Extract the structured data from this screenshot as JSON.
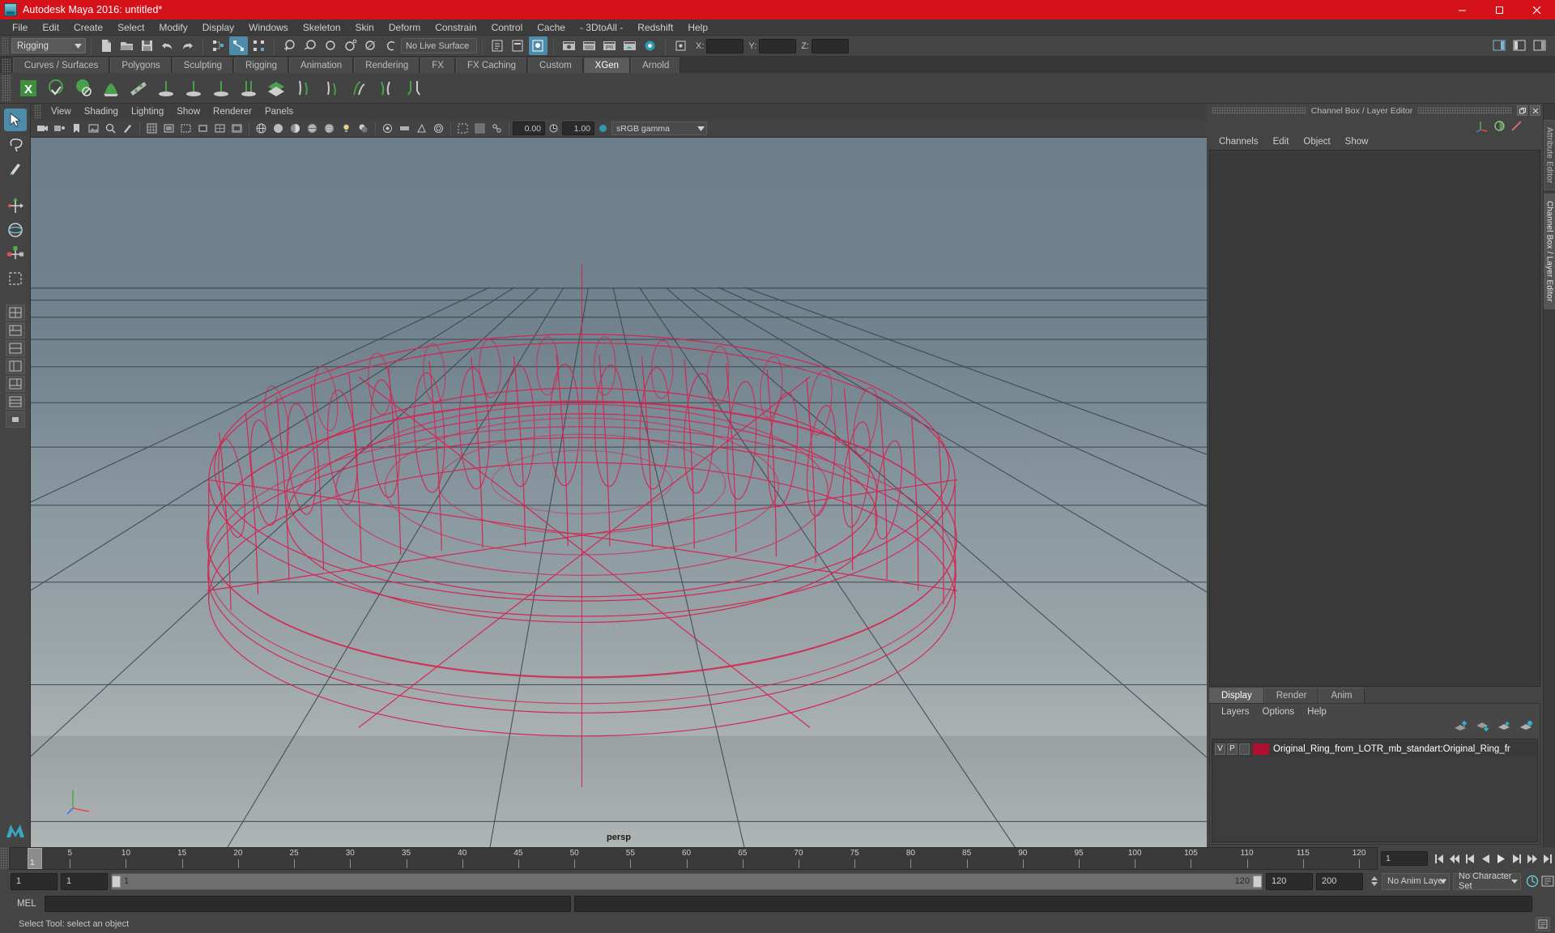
{
  "window": {
    "title": "Autodesk Maya 2016: untitled*",
    "app_icon": "maya-logo-icon",
    "buttons": [
      {
        "name": "minimize-button",
        "glyph": "minimize-icon"
      },
      {
        "name": "maximize-button",
        "glyph": "maximize-icon"
      },
      {
        "name": "close-button",
        "glyph": "close-icon"
      }
    ],
    "titlebar_color": "#d5121a"
  },
  "menubar": {
    "items": [
      "File",
      "Edit",
      "Create",
      "Select",
      "Modify",
      "Display",
      "Windows",
      "Skeleton",
      "Skin",
      "Deform",
      "Constrain",
      "Control",
      "Cache",
      "- 3DtoAll -",
      "Redshift",
      "Help"
    ]
  },
  "statusbar": {
    "mode": "Rigging",
    "live_surface": "No Live Surface",
    "coords": [
      {
        "label": "X:",
        "value": ""
      },
      {
        "label": "Y:",
        "value": ""
      },
      {
        "label": "Z:",
        "value": ""
      }
    ]
  },
  "shelf": {
    "tabs": [
      "Curves / Surfaces",
      "Polygons",
      "Sculpting",
      "Rigging",
      "Animation",
      "Rendering",
      "FX",
      "FX Caching",
      "Custom",
      "XGen",
      "Arnold"
    ],
    "active_tab": "XGen",
    "icons": [
      "xgen-logo-icon",
      "xgen-preview-icon",
      "xgen-render-icon",
      "xgen-description-icon",
      "xgen-guide-icon",
      "xgen-clump-icon",
      "xgen-noise-icon",
      "xgen-cut-icon",
      "xgen-coil-icon",
      "xgen-collection-icon",
      "xgen-groom-add-icon",
      "xgen-groom-density-icon",
      "xgen-groom-length-icon",
      "xgen-groom-width-icon",
      "xgen-groom-mask-icon"
    ]
  },
  "toolbox": {
    "tools": [
      "select-tool-icon",
      "lasso-select-icon",
      "paint-select-icon",
      "move-tool-icon",
      "rotate-tool-icon",
      "scale-tool-icon",
      "last-tool-icon",
      "four-view-layout-icon",
      "single-perspective-icon",
      "two-pane-stacked-icon",
      "outliner-persp-icon",
      "persp-graph-icon",
      "hypershade-persp-icon",
      "persp-toggle-icon"
    ],
    "selected": "select-tool-icon",
    "logo": "maya-logo-icon"
  },
  "viewport": {
    "panel_menus": [
      "View",
      "Shading",
      "Lighting",
      "Show",
      "Renderer",
      "Panels"
    ],
    "camera_label": "persp",
    "toolbar": {
      "exposure": "0.00",
      "gamma": "1.00",
      "color_management": "sRGB gamma"
    },
    "wireframe_color": "#d4234f",
    "object": "torus-ring-wireframe",
    "grid": true,
    "axis_gizmo": "axis-gizmo-icon"
  },
  "right_dock": {
    "panel_title": "Channel Box / Layer Editor",
    "channel_box": {
      "menus": [
        "Channels",
        "Edit",
        "Object",
        "Show"
      ],
      "icons": [
        "channel-box-icon",
        "attribute-editor-icon",
        "anim-layer-icon"
      ]
    },
    "layer_editor": {
      "tabs": [
        "Display",
        "Render",
        "Anim"
      ],
      "active_tab": "Display",
      "menus": [
        "Layers",
        "Options",
        "Help"
      ],
      "buttons": [
        "layer-move-up-icon",
        "layer-move-down-icon",
        "layer-new-icon",
        "layer-new-from-selected-icon"
      ],
      "layers": [
        {
          "visibility": "V",
          "playback": "P",
          "shading": "",
          "color": "#b01030",
          "name": "Original_Ring_from_LOTR_mb_standart:Original_Ring_fr"
        }
      ]
    },
    "vertical_tabs": [
      "Attribute Editor",
      "Channel Box / Layer Editor"
    ]
  },
  "timeline": {
    "ticks": [
      5,
      10,
      15,
      20,
      25,
      30,
      35,
      40,
      45,
      50,
      55,
      60,
      65,
      70,
      75,
      80,
      85,
      90,
      95,
      100,
      105,
      110,
      115,
      120
    ],
    "current_frame": "1",
    "frame_field": "1",
    "playback_buttons": [
      "go-to-start-icon",
      "step-back-keyframe-icon",
      "step-back-frame-icon",
      "play-backward-icon",
      "play-forward-icon",
      "step-forward-frame-icon",
      "step-forward-keyframe-icon",
      "go-to-end-icon"
    ]
  },
  "range_slider": {
    "start": "1",
    "anim_start": "1",
    "range_start": "1",
    "range_end": "120",
    "anim_end": "120",
    "playback_end": "200",
    "anim_layer": "No Anim Layer",
    "character_set": "No Character Set",
    "auto_key_icon": "auto-keyframe-icon",
    "anim_prefs_icon": "animation-preferences-icon"
  },
  "command_line": {
    "language": "MEL",
    "input_value": "",
    "output_value": ""
  },
  "status_line": {
    "message": "Select Tool: select an object",
    "help_icon": "help-line-icon"
  }
}
